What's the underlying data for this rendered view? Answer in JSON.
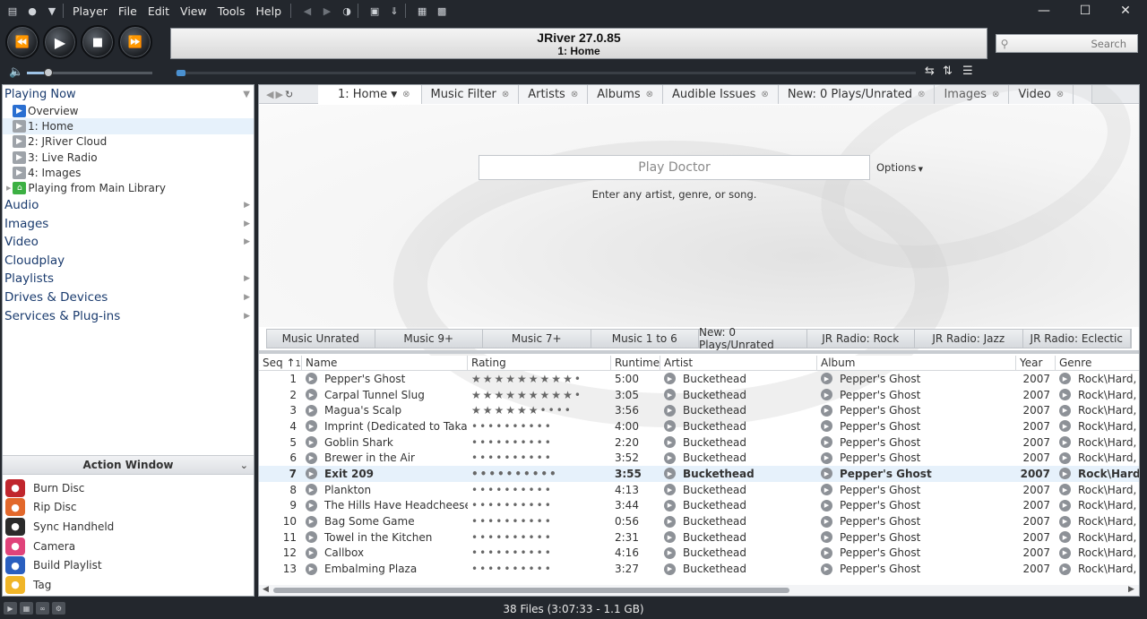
{
  "menu": [
    "Player",
    "File",
    "Edit",
    "View",
    "Tools",
    "Help"
  ],
  "display": {
    "line1": "JRiver 27.0.85",
    "line2": "1: Home"
  },
  "search": {
    "placeholder": "Search"
  },
  "volume": {
    "level": 0.17
  },
  "seek": {
    "position": 0.0
  },
  "tree": {
    "playing_now": "Playing Now",
    "items": [
      {
        "label": "Overview",
        "color": "#2a6fd1",
        "selected": false
      },
      {
        "label": "1: Home",
        "color": "#9ea3a9",
        "selected": true
      },
      {
        "label": "2: JRiver Cloud",
        "color": "#9ea3a9",
        "selected": false
      },
      {
        "label": "3: Live Radio",
        "color": "#9ea3a9",
        "selected": false
      },
      {
        "label": "4: Images",
        "color": "#9ea3a9",
        "selected": false
      },
      {
        "label": "Playing from Main Library",
        "color": "#3cb043",
        "selected": false
      }
    ],
    "categories": [
      {
        "label": "Audio",
        "arrow": true
      },
      {
        "label": "Images",
        "arrow": true
      },
      {
        "label": "Video",
        "arrow": true
      },
      {
        "label": "Cloudplay",
        "arrow": false
      },
      {
        "label": "Playlists",
        "arrow": true
      },
      {
        "label": "Drives & Devices",
        "arrow": true
      },
      {
        "label": "Services & Plug-ins",
        "arrow": true
      }
    ]
  },
  "action_window": {
    "title": "Action Window",
    "items": [
      {
        "label": "Burn Disc",
        "color": "#c0262d",
        "icon": "burn-disc-icon"
      },
      {
        "label": "Rip Disc",
        "color": "#e2682b",
        "icon": "rip-disc-icon"
      },
      {
        "label": "Sync Handheld",
        "color": "#2b2b2b",
        "icon": "sync-handheld-icon"
      },
      {
        "label": "Camera",
        "color": "#e0437a",
        "icon": "camera-icon"
      },
      {
        "label": "Build Playlist",
        "color": "#2a5fbf",
        "icon": "build-playlist-icon"
      },
      {
        "label": "Tag",
        "color": "#f0b528",
        "icon": "tag-icon"
      }
    ]
  },
  "tabs": [
    {
      "label": "1: Home",
      "active": true,
      "dropdown": true
    },
    {
      "label": "Music Filter",
      "active": false
    },
    {
      "label": "Artists",
      "active": false
    },
    {
      "label": "Albums",
      "active": false
    },
    {
      "label": "Audible Issues",
      "active": false
    },
    {
      "label": "New: 0 Plays/Unrated",
      "active": false
    },
    {
      "label": "Images",
      "active": false
    },
    {
      "label": "Video",
      "active": false
    }
  ],
  "play_doctor": {
    "placeholder": "Play Doctor",
    "options": "Options",
    "hint": "Enter any artist, genre, or song."
  },
  "quick_tabs": [
    "Music Unrated",
    "Music 9+",
    "Music 7+",
    "Music 1 to 6",
    "New: 0 Plays/Unrated",
    "JR Radio: Rock",
    "JR Radio: Jazz",
    "JR Radio: Eclectic"
  ],
  "table": {
    "columns": [
      "Seq",
      "1",
      "Name",
      "Rating",
      "Runtime",
      "Artist",
      "Album",
      "Year",
      "Genre"
    ],
    "rows": [
      {
        "seq": "1",
        "name": "Pepper's Ghost",
        "rating": 9,
        "runtime": "5:00",
        "artist": "Buckethead",
        "album": "Pepper's Ghost",
        "year": "2007",
        "genre": "Rock\\Hard, P",
        "highlight": false
      },
      {
        "seq": "2",
        "name": "Carpal Tunnel Slug",
        "rating": 9,
        "runtime": "3:05",
        "artist": "Buckethead",
        "album": "Pepper's Ghost",
        "year": "2007",
        "genre": "Rock\\Hard, P",
        "highlight": false
      },
      {
        "seq": "3",
        "name": "Magua's Scalp",
        "rating": 6,
        "runtime": "3:56",
        "artist": "Buckethead",
        "album": "Pepper's Ghost",
        "year": "2007",
        "genre": "Rock\\Hard, P",
        "highlight": false
      },
      {
        "seq": "4",
        "name": "Imprint (Dedicated to Takash...",
        "rating": 0,
        "runtime": "4:00",
        "artist": "Buckethead",
        "album": "Pepper's Ghost",
        "year": "2007",
        "genre": "Rock\\Hard, P",
        "highlight": false
      },
      {
        "seq": "5",
        "name": "Goblin Shark",
        "rating": 0,
        "runtime": "2:20",
        "artist": "Buckethead",
        "album": "Pepper's Ghost",
        "year": "2007",
        "genre": "Rock\\Hard, P",
        "highlight": false
      },
      {
        "seq": "6",
        "name": "Brewer in the Air",
        "rating": 0,
        "runtime": "3:52",
        "artist": "Buckethead",
        "album": "Pepper's Ghost",
        "year": "2007",
        "genre": "Rock\\Hard, P",
        "highlight": false
      },
      {
        "seq": "7",
        "name": "Exit 209",
        "rating": 0,
        "runtime": "3:55",
        "artist": "Buckethead",
        "album": "Pepper's Ghost",
        "year": "2007",
        "genre": "Rock\\Hard,",
        "highlight": true
      },
      {
        "seq": "8",
        "name": "Plankton",
        "rating": 0,
        "runtime": "4:13",
        "artist": "Buckethead",
        "album": "Pepper's Ghost",
        "year": "2007",
        "genre": "Rock\\Hard, P",
        "highlight": false
      },
      {
        "seq": "9",
        "name": "The Hills Have Headcheese",
        "rating": 0,
        "runtime": "3:44",
        "artist": "Buckethead",
        "album": "Pepper's Ghost",
        "year": "2007",
        "genre": "Rock\\Hard, P",
        "highlight": false
      },
      {
        "seq": "10",
        "name": "Bag Some Game",
        "rating": 0,
        "runtime": "0:56",
        "artist": "Buckethead",
        "album": "Pepper's Ghost",
        "year": "2007",
        "genre": "Rock\\Hard, P",
        "highlight": false
      },
      {
        "seq": "11",
        "name": "Towel in the Kitchen",
        "rating": 0,
        "runtime": "2:31",
        "artist": "Buckethead",
        "album": "Pepper's Ghost",
        "year": "2007",
        "genre": "Rock\\Hard, P",
        "highlight": false
      },
      {
        "seq": "12",
        "name": "Callbox",
        "rating": 0,
        "runtime": "4:16",
        "artist": "Buckethead",
        "album": "Pepper's Ghost",
        "year": "2007",
        "genre": "Rock\\Hard, P",
        "highlight": false
      },
      {
        "seq": "13",
        "name": "Embalming Plaza",
        "rating": 0,
        "runtime": "3:27",
        "artist": "Buckethead",
        "album": "Pepper's Ghost",
        "year": "2007",
        "genre": "Rock\\Hard, P",
        "highlight": false
      }
    ]
  },
  "status": "38 Files (3:07:33 - 1.1 GB)"
}
